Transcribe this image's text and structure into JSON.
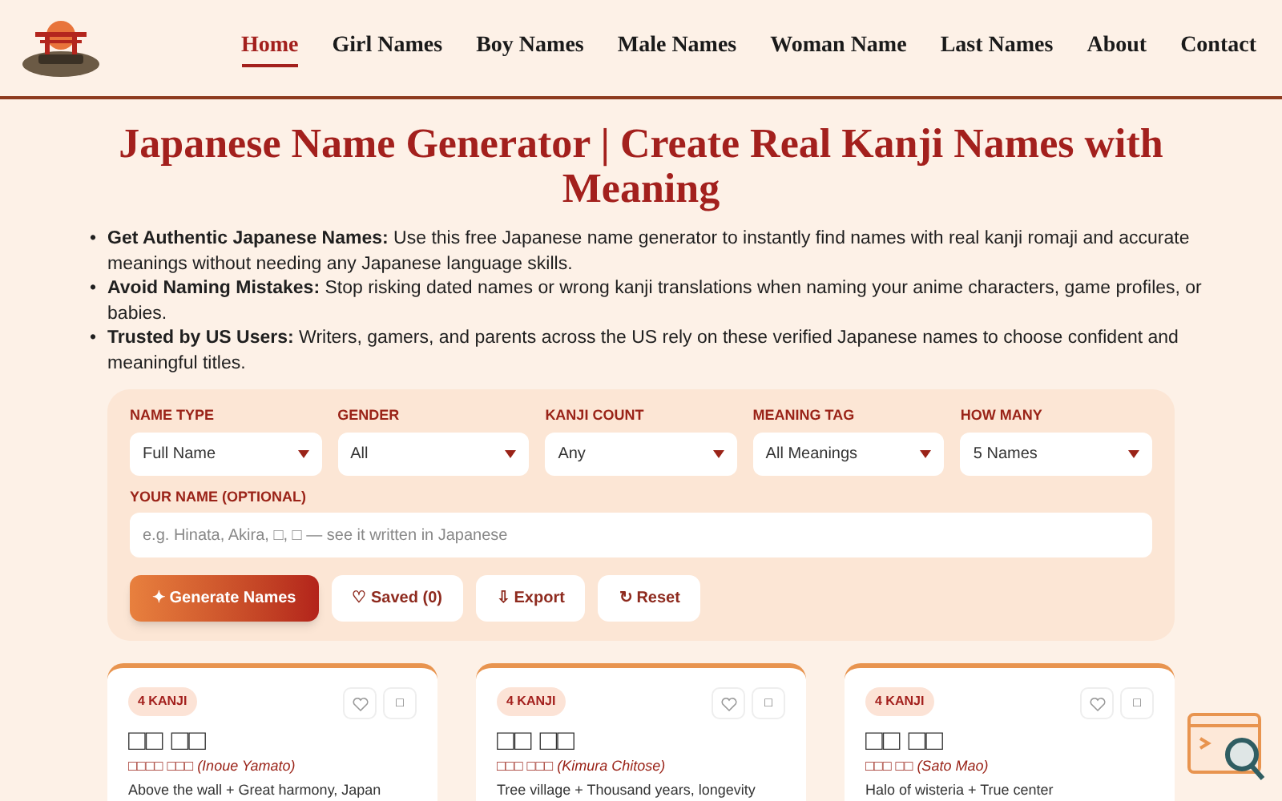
{
  "nav": {
    "items": [
      {
        "label": "Home",
        "selected": true
      },
      {
        "label": "Girl Names",
        "selected": false
      },
      {
        "label": "Boy Names",
        "selected": false
      },
      {
        "label": "Male Names",
        "selected": false
      },
      {
        "label": "Woman Name",
        "selected": false
      },
      {
        "label": "Last Names",
        "selected": false
      },
      {
        "label": "About",
        "selected": false
      },
      {
        "label": "Contact",
        "selected": false
      }
    ]
  },
  "title": "Japanese Name Generator | Create Real Kanji Names with Meaning",
  "bullet_marker": "•",
  "bullets": [
    "**Get Authentic Japanese Names:** Use this free Japanese name generator to instantly find names with real kanji romaji and accurate meanings without needing any Japanese language skills.",
    "**Avoid Naming Mistakes:** Stop risking dated names or wrong kanji translations when naming your anime characters, game profiles, or babies.",
    "**Trusted by US Users:** Writers, gamers, and parents across the US rely on these verified Japanese names to choose confident and meaningful titles."
  ],
  "form": {
    "selects": [
      {
        "label": "NAME TYPE",
        "value": "Full Name"
      },
      {
        "label": "GENDER",
        "value": "All"
      },
      {
        "label": "KANJI COUNT",
        "value": "Any"
      },
      {
        "label": "MEANING TAG",
        "value": "All Meanings"
      },
      {
        "label": "HOW MANY",
        "value": "5 Names"
      }
    ],
    "name_field": {
      "label": "YOUR NAME (OPTIONAL)",
      "placeholder": "e.g. Hinata, Akira, □, □ — see it written in Japanese"
    },
    "buttons": [
      {
        "kind": "primary",
        "icon": "✦",
        "label": "Generate Names"
      },
      {
        "kind": "secondary",
        "icon": "♡",
        "label": "Saved (0)"
      },
      {
        "kind": "secondary",
        "icon": "⇩",
        "label": "Export"
      },
      {
        "kind": "secondary",
        "icon": "↻",
        "label": "Reset"
      }
    ]
  },
  "cards": [
    {
      "badge": "4 KANJI",
      "name": "□□ □□",
      "reading": "□□□□ □□□ *(Inoue Yamato)*",
      "meaning": "Above the wall + Great harmony, Japan"
    },
    {
      "badge": "4 KANJI",
      "name": "□□ □□",
      "reading": "□□□ □□□ *(Kimura Chitose)*",
      "meaning": "Tree village + Thousand years, longevity"
    },
    {
      "badge": "4 KANJI",
      "name": "□□ □□",
      "reading": "□□□ □□ *(Sato Mao)*",
      "meaning": "Halo of wisteria + True center"
    }
  ],
  "card_copy_icon": "□"
}
